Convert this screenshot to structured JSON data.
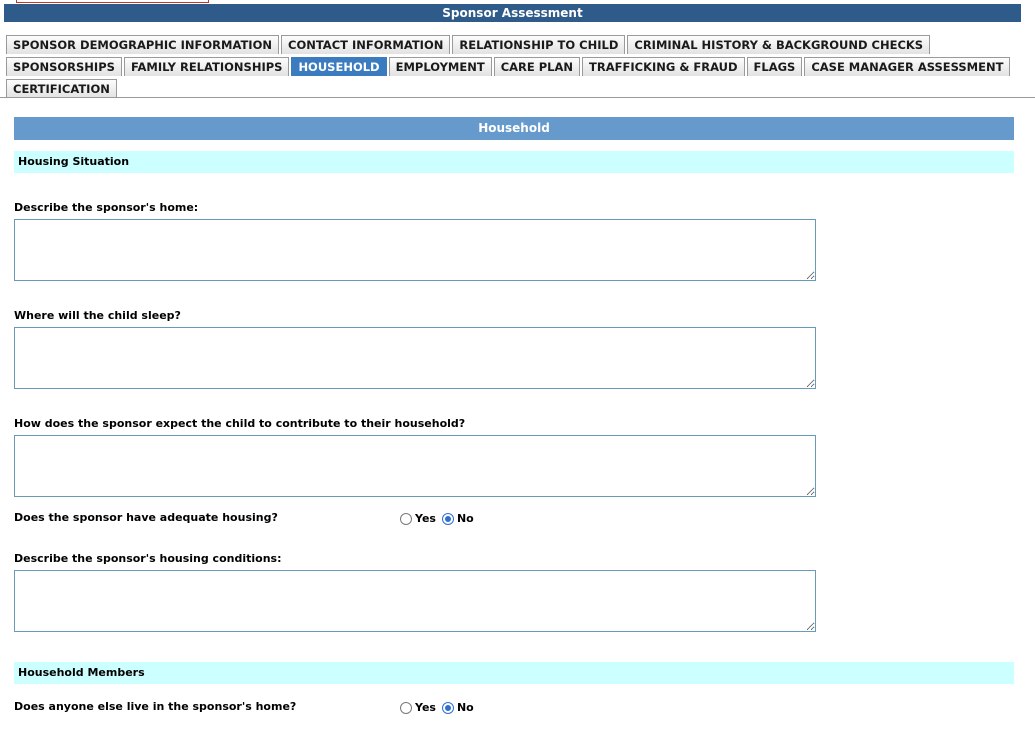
{
  "title": "Sponsor Assessment",
  "tabs_row1": [
    {
      "label": "SPONSOR DEMOGRAPHIC INFORMATION",
      "active": false
    },
    {
      "label": "CONTACT INFORMATION",
      "active": false
    },
    {
      "label": "RELATIONSHIP TO CHILD",
      "active": false
    },
    {
      "label": "CRIMINAL HISTORY & BACKGROUND CHECKS",
      "active": false
    }
  ],
  "tabs_row2": [
    {
      "label": "SPONSORSHIPS",
      "active": false
    },
    {
      "label": "FAMILY RELATIONSHIPS",
      "active": false
    },
    {
      "label": "HOUSEHOLD",
      "active": true
    },
    {
      "label": "EMPLOYMENT",
      "active": false
    },
    {
      "label": "CARE PLAN",
      "active": false
    },
    {
      "label": "TRAFFICKING & FRAUD",
      "active": false
    },
    {
      "label": "FLAGS",
      "active": false
    },
    {
      "label": "CASE MANAGER ASSESSMENT",
      "active": false
    }
  ],
  "tabs_row3": [
    {
      "label": "CERTIFICATION",
      "active": false
    }
  ],
  "section_title": "Household",
  "housing": {
    "subheader": "Housing Situation",
    "q_home": "Describe the sponsor's home:",
    "q_home_value": "",
    "q_sleep": "Where will the child sleep?",
    "q_sleep_value": "",
    "q_contribute": "How does the sponsor expect the child to contribute to their household?",
    "q_contribute_value": "",
    "q_adequate": "Does the sponsor have adequate housing?",
    "q_adequate_value": "No",
    "q_conditions": "Describe the sponsor's housing conditions:",
    "q_conditions_value": ""
  },
  "members": {
    "subheader": "Household Members",
    "q_anyone": "Does anyone else live in the sponsor's home?",
    "q_anyone_value": "No"
  },
  "radio_yes": "Yes",
  "radio_no": "No",
  "colors": {
    "titlebar": "#2e5b8a",
    "active_tab": "#3b7cc0",
    "section_header": "#6699cc",
    "subheader": "#ccffff"
  }
}
